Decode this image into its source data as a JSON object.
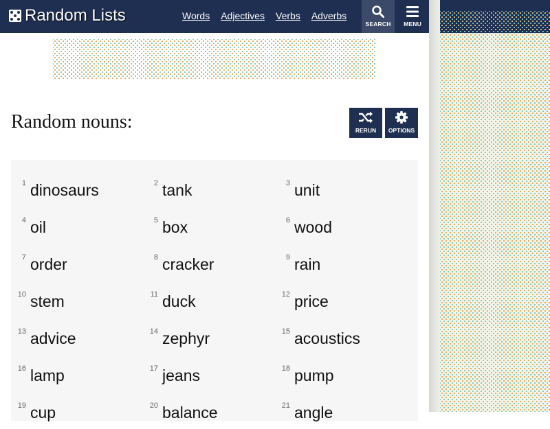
{
  "header": {
    "logo_text": "Random Lists",
    "nav": [
      "Words",
      "Adjectives",
      "Verbs",
      "Adverbs"
    ],
    "search_label": "SEARCH",
    "menu_label": "MENU"
  },
  "main": {
    "heading": "Random nouns:",
    "rerun_label": "RERUN",
    "options_label": "OPTIONS"
  },
  "items": [
    {
      "n": "1",
      "w": "dinosaurs"
    },
    {
      "n": "2",
      "w": "tank"
    },
    {
      "n": "3",
      "w": "unit"
    },
    {
      "n": "4",
      "w": "oil"
    },
    {
      "n": "5",
      "w": "box"
    },
    {
      "n": "6",
      "w": "wood"
    },
    {
      "n": "7",
      "w": "order"
    },
    {
      "n": "8",
      "w": "cracker"
    },
    {
      "n": "9",
      "w": "rain"
    },
    {
      "n": "10",
      "w": "stem"
    },
    {
      "n": "11",
      "w": "duck"
    },
    {
      "n": "12",
      "w": "price"
    },
    {
      "n": "13",
      "w": "advice"
    },
    {
      "n": "14",
      "w": "zephyr"
    },
    {
      "n": "15",
      "w": "acoustics"
    },
    {
      "n": "16",
      "w": "lamp"
    },
    {
      "n": "17",
      "w": "jeans"
    },
    {
      "n": "18",
      "w": "pump"
    },
    {
      "n": "19",
      "w": "cup"
    },
    {
      "n": "20",
      "w": "balance"
    },
    {
      "n": "21",
      "w": "angle"
    }
  ],
  "colors": {
    "navy": "#1e2f52",
    "search_bg": "#3b4a68",
    "list_bg": "#f6f6f6"
  },
  "icons": {
    "logo": "dice-icon",
    "search": "search-icon",
    "menu": "menu-icon",
    "rerun": "shuffle-icon",
    "options": "gear-icon"
  }
}
